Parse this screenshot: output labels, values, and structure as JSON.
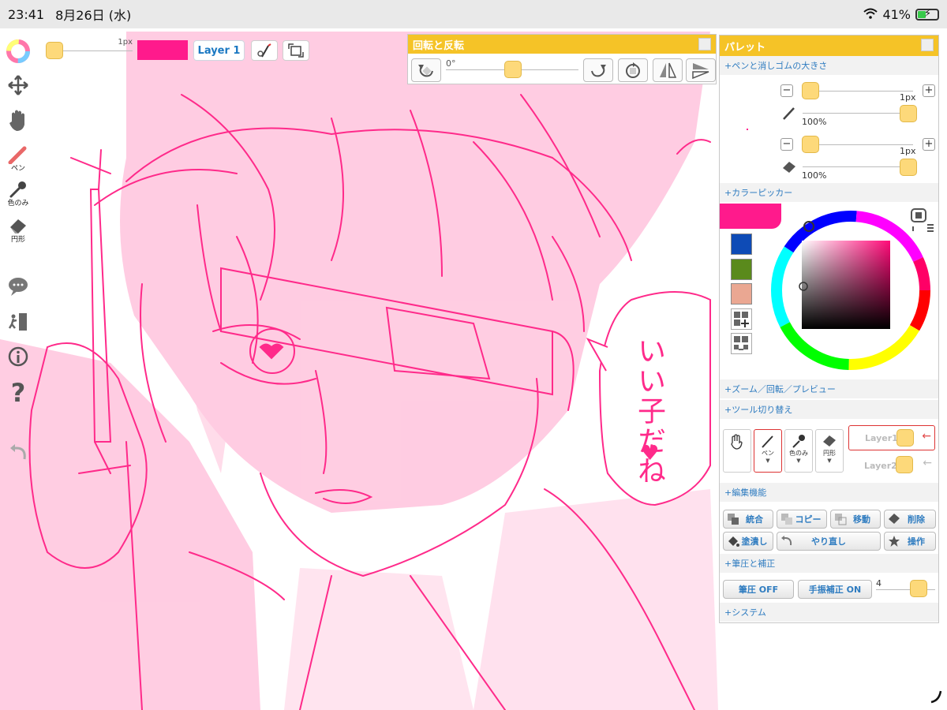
{
  "status_bar": {
    "time": "23:41",
    "date": "8月26日 (水)",
    "battery": "41%"
  },
  "toolbar": {
    "brush_size": "1px",
    "current_color": "#ff1a8c",
    "layer_label": "Layer 1"
  },
  "left_tools": {
    "pen": "ペン",
    "eyedropper": "色のみ",
    "shape": "円形"
  },
  "rotation_panel": {
    "title": "回転と反転",
    "angle": "0°"
  },
  "palette": {
    "title": "パレット",
    "pen_eraser_section": "+ペンと消しゴムの大きさ",
    "pen_size": "1px",
    "pen_opacity": "100%",
    "eraser_size": "1px",
    "eraser_opacity": "100%",
    "color_picker_section": "+カラーピッカー",
    "current_color": "#ff1a8c",
    "swatches": [
      "#0e4bb6",
      "#5a8a1c",
      "#eaa792"
    ],
    "zoom_section": "+ズーム／回転／プレビュー",
    "tool_switch_section": "+ツール切り替え",
    "tools": [
      "ペン",
      "色のみ",
      "円形"
    ],
    "layers": [
      "Layer1",
      "Layer2"
    ],
    "edit_section": "+編集機能",
    "edit_buttons": [
      "統合",
      "コピー",
      "移動",
      "削除",
      "塗潰し",
      "やり直し",
      "操作"
    ],
    "pressure_section": "+筆圧と補正",
    "pressure_off": "筆圧 OFF",
    "stabilizer_on": "手振補正 ON",
    "stabilizer_value": "4",
    "system_section": "+システム"
  },
  "artwork": {
    "speech_text": "いい子だね"
  },
  "colors": {
    "accent": "#f5c327",
    "ink": "#ff2a8a",
    "wash": "#ffc6e0",
    "link": "#2f7cc0"
  }
}
